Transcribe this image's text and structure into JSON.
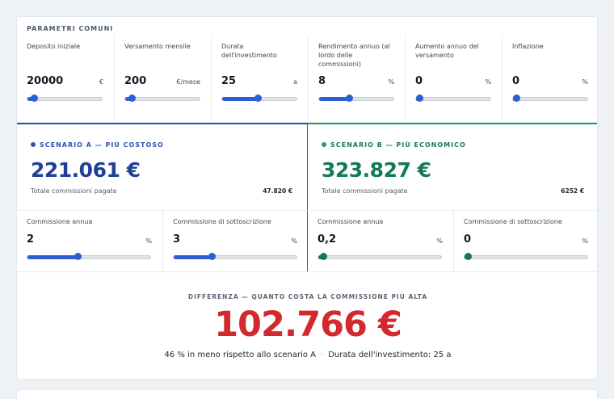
{
  "common": {
    "title": "PARAMETRI COMUNI",
    "params": [
      {
        "label": "Deposito iniziale",
        "value": "20000",
        "unit": "€",
        "slider": 0.09
      },
      {
        "label": "Versamento mensile",
        "value": "200",
        "unit": "€/mese",
        "slider": 0.09
      },
      {
        "label": "Durata dell'investimento",
        "value": "25",
        "unit": "a",
        "slider": 0.48
      },
      {
        "label": "Rendimento annuo (al lordo delle commissioni)",
        "value": "8",
        "unit": "%",
        "slider": 0.4
      },
      {
        "label": "Aumento annuo del versamento",
        "value": "0",
        "unit": "%",
        "slider": 0.0
      },
      {
        "label": "Inflazione",
        "value": "0",
        "unit": "%",
        "slider": 0.0
      }
    ]
  },
  "scenario_a": {
    "title": "SCENARIO A — PIÙ COSTOSO",
    "color": "#2c52b8",
    "amount_color": "#1f3f99",
    "amount": "221.061 €",
    "total_label": "Totale commissioni pagate",
    "total_value": "47.820 €",
    "fields": [
      {
        "label": "Commissione annua",
        "value": "2",
        "unit": "%",
        "slider": 0.41
      },
      {
        "label": "Commissione di sottoscrizione",
        "value": "3",
        "unit": "%",
        "slider": 0.31
      }
    ]
  },
  "scenario_b": {
    "title": "SCENARIO B — PIÙ ECONOMICO",
    "color": "#1e9e6a",
    "amount_color": "#157a52",
    "amount": "323.827 €",
    "total_label": "Totale commissioni pagate",
    "total_value": "6252 €",
    "fields": [
      {
        "label": "Commissione annua",
        "value": "0,2",
        "unit": "%",
        "slider": 0.04
      },
      {
        "label": "Commissione di sottoscrizione",
        "value": "0",
        "unit": "%",
        "slider": 0.0
      }
    ]
  },
  "difference": {
    "title": "DIFFERENZA — QUANTO COSTA LA COMMISSIONE PIÙ ALTA",
    "amount": "102.766 €",
    "note_left": "46 % in meno rispetto allo scenario A",
    "separator": "·",
    "note_right": "Durata dell'investimento: 25 a"
  },
  "colors": {
    "common_slider": "#2c5fd6",
    "scenario_a_slider": "#2c5fd6",
    "scenario_b_slider": "#157a52"
  }
}
